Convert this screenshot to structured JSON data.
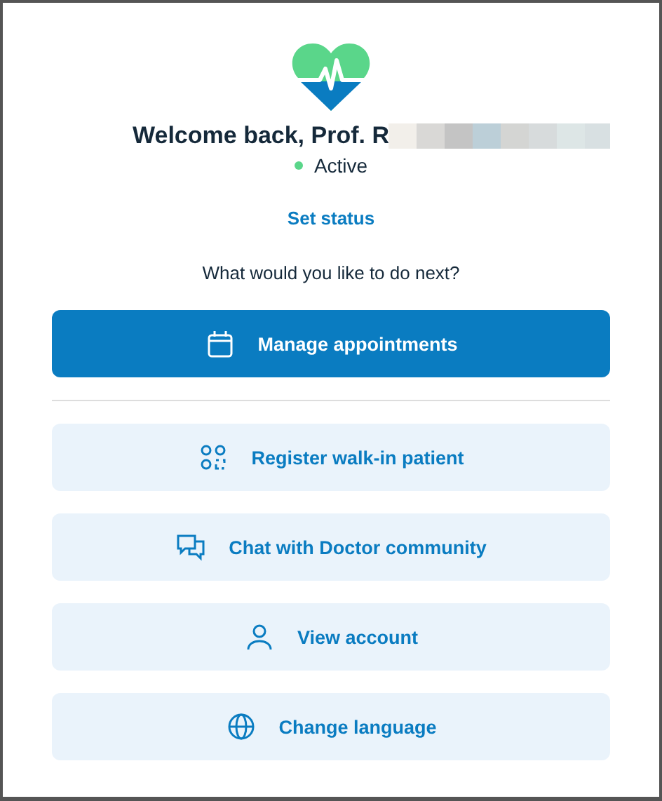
{
  "header": {
    "greeting": "Welcome back, Prof. R",
    "name_redacted": true
  },
  "status": {
    "label": "Active",
    "online": true
  },
  "set_status_link": "Set status",
  "prompt": "What would you like to do next?",
  "actions": [
    {
      "label": "Manage appointments",
      "kind": "primary"
    },
    {
      "label": "Register walk-in patient",
      "kind": "secondary"
    },
    {
      "label": "Chat with Doctor community",
      "kind": "secondary"
    },
    {
      "label": "View account",
      "kind": "secondary"
    },
    {
      "label": "Change language",
      "kind": "secondary"
    }
  ]
}
